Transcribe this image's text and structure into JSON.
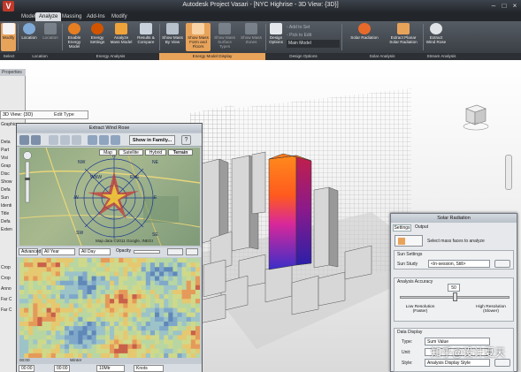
{
  "app": {
    "title": "Autodesk Project Vasari - [NYC Highrise - 3D View: {3D}]",
    "logo": "V"
  },
  "menu": {
    "tabs": [
      "Model",
      "Analyze",
      "Massing",
      "Add-Ins",
      "Modify"
    ],
    "active": 1
  },
  "ribbon": {
    "buttons": [
      {
        "label": "Modify",
        "icon": "cursor-icon",
        "hl": true
      },
      {
        "label": "Location",
        "icon": "location-icon"
      },
      {
        "label": "Location",
        "icon": "project-location-icon"
      },
      {
        "label": "Enable Energy Model",
        "icon": "energy-model-icon"
      },
      {
        "label": "Energy Settings",
        "icon": "energy-settings-icon"
      },
      {
        "label": "Analyze Mass Model",
        "icon": "analyze-mass-icon"
      },
      {
        "label": "Results & Compare",
        "icon": "results-compare-icon"
      },
      {
        "label": "Show Mass By View",
        "icon": "show-mass-icon"
      },
      {
        "label": "Show Mass Form and Floors",
        "icon": "mass-floors-icon",
        "hl": true
      },
      {
        "label": "Show Mass Surface Types",
        "icon": "mass-surface-icon"
      },
      {
        "label": "Show Mass Zones",
        "icon": "mass-zones-icon"
      },
      {
        "label": "Design Options",
        "icon": "design-options-icon"
      },
      {
        "label": "Add to Set",
        "icon": "add-set-icon"
      },
      {
        "label": "Pick to Edit",
        "icon": "pick-edit-icon"
      },
      {
        "label": "Main Model",
        "icon": "main-model-icon"
      },
      {
        "label": "Solar Radiation",
        "icon": "solar-radiation-icon"
      },
      {
        "label": "Extract Planar Solar Radiation",
        "icon": "planar-solar-icon"
      },
      {
        "label": "Extract Wind Rose",
        "icon": "wind-rose-icon"
      }
    ],
    "panels": [
      {
        "label": "Select"
      },
      {
        "label": "Location"
      },
      {
        "label": "Energy Analysis"
      },
      {
        "label": "Energy Model Display",
        "hl": true
      },
      {
        "label": "Design Options"
      },
      {
        "label": "Solar Analysis"
      },
      {
        "label": "Stream Analysis"
      }
    ]
  },
  "left_panel": {
    "title": "Properties",
    "view_type": "3D View: {3D}",
    "edit_type": "Edit Type",
    "items": [
      "Graphics",
      "Deta",
      "Part",
      "Visi",
      "Grap",
      "Disc",
      "Show",
      "Defa",
      "Sun",
      "Identi",
      "Title",
      "Defa",
      "Exten",
      "Crop",
      "Crop",
      "Anno",
      "Far C",
      "Far C"
    ]
  },
  "wind_rose": {
    "title": "Extract Wind Rose",
    "show_in_family": "Show in Family...",
    "map_tabs": [
      "Map",
      "Satellite",
      "Hybrid",
      "Terrain"
    ],
    "map_footer": "Map data ©2011 Google, INEGI",
    "controls": {
      "mode": "Advanced",
      "years": "All Year",
      "days": "All Day",
      "opacity": "Opacity"
    },
    "axis_start": "00:00",
    "axis_label": "Winter",
    "bottom": {
      "time": "00:00",
      "time2": "00:00",
      "speed": "10Mtr",
      "unit": "Knots"
    }
  },
  "solar": {
    "title": "Solar Radiation",
    "tabs": [
      "Settings",
      "Output"
    ],
    "select_label": "Select mass faces to analyze",
    "sun_settings": "Sun Settings",
    "sun_study_label": "Sun Study",
    "sun_study_value": "<In-session, Still>",
    "analysis_accuracy": "Analysis Accuracy",
    "accuracy_value": "50",
    "accuracy_level": 0.5,
    "low_label": "Low Resolution (Faster)",
    "high_label": "High Resolution (Slower)",
    "data_display": "Data Display",
    "type_label": "Type:",
    "type_value": "Sum Value",
    "unit_label": "Unit:",
    "style_label": "Style:",
    "style_value": "Analysis Display Style"
  },
  "watermark": "知乎@设计夏天",
  "colors": {
    "accent": "#e8a35a",
    "ribbon_bg": "#4a4f56",
    "hot": "#ff5a1e",
    "cold": "#3a2ec8"
  }
}
